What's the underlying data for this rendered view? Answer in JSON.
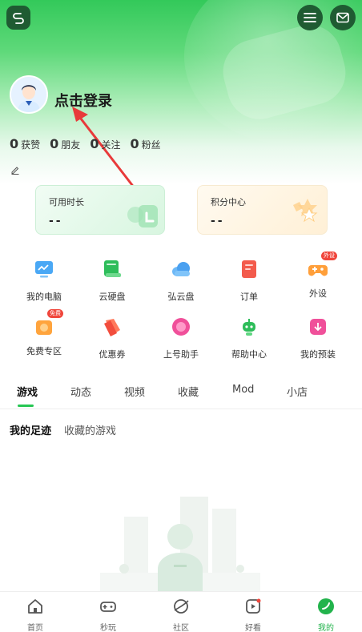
{
  "header": {
    "login_prompt": "点击登录"
  },
  "stats": [
    {
      "value": "0",
      "label": "获赞"
    },
    {
      "value": "0",
      "label": "朋友"
    },
    {
      "value": "0",
      "label": "关注"
    },
    {
      "value": "0",
      "label": "粉丝"
    }
  ],
  "cards": {
    "time": {
      "title": "可用时长",
      "value": "--"
    },
    "points": {
      "title": "积分中心",
      "value": "--"
    }
  },
  "grid": [
    {
      "label": "我的电脑",
      "icon": "computer-icon"
    },
    {
      "label": "云硬盘",
      "icon": "cloud-disk-icon"
    },
    {
      "label": "弘云盘",
      "icon": "cloud-icon"
    },
    {
      "label": "订单",
      "icon": "order-icon"
    },
    {
      "label": "外设",
      "icon": "gamepad-icon",
      "badge": "外设"
    },
    {
      "label": "免费专区",
      "icon": "free-zone-icon",
      "badge": "免费"
    },
    {
      "label": "优惠券",
      "icon": "coupon-icon"
    },
    {
      "label": "上号助手",
      "icon": "login-helper-icon"
    },
    {
      "label": "帮助中心",
      "icon": "robot-icon"
    },
    {
      "label": "我的预装",
      "icon": "preinstall-icon"
    }
  ],
  "tabs": [
    "游戏",
    "动态",
    "视频",
    "收藏",
    "Mod",
    "小店"
  ],
  "subtabs": [
    "我的足迹",
    "收藏的游戏"
  ],
  "bottom_nav": [
    {
      "label": "首页",
      "icon": "home-icon"
    },
    {
      "label": "秒玩",
      "icon": "gamepad-icon"
    },
    {
      "label": "社区",
      "icon": "community-icon"
    },
    {
      "label": "好看",
      "icon": "video-icon"
    },
    {
      "label": "我的",
      "icon": "profile-icon",
      "active": true
    }
  ],
  "colors": {
    "brand_green": "#26c653",
    "header_dark": "#1f5b32"
  }
}
